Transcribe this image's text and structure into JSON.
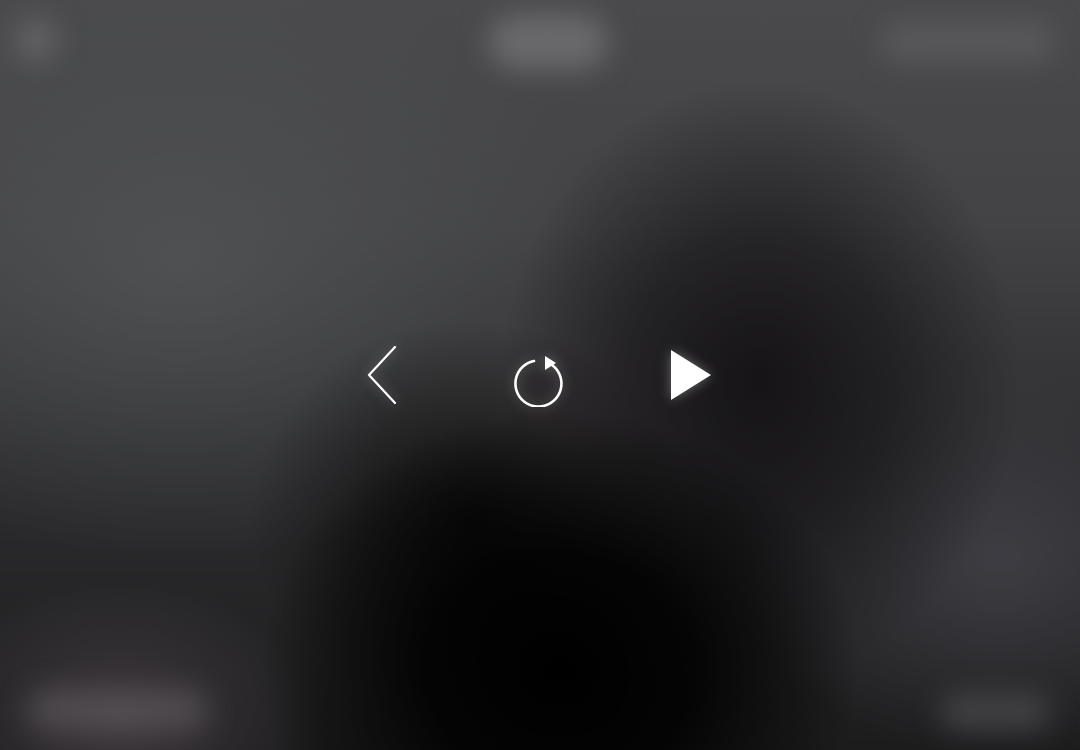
{
  "player": {
    "state": "paused",
    "controls": [
      {
        "id": "back",
        "icon": "chevron-left-icon"
      },
      {
        "id": "replay",
        "icon": "replay-icon"
      },
      {
        "id": "play",
        "icon": "play-icon"
      }
    ]
  },
  "colors": {
    "icon": "#ffffff",
    "overlay_dark": "#1c1c1d",
    "overlay_light": "#4a4a4c"
  }
}
